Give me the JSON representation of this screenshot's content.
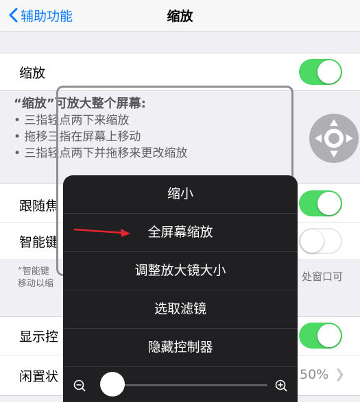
{
  "nav": {
    "back_label": "辅助功能",
    "title": "缩放"
  },
  "rows": {
    "zoom_label": "缩放",
    "follow_focus_label": "跟随焦",
    "smart_keyboard_label": "智能键",
    "show_controller_label": "显示控",
    "idle_label": "闲置状",
    "idle_value": "50%"
  },
  "description": {
    "title": "“缩放”可放大整个屏幕:",
    "bullet1": "• 三指轻点两下来缩放",
    "bullet2": "• 拖移三指在屏幕上移动",
    "bullet3": "• 三指轻点两下并拖移来更改缩放"
  },
  "note": {
    "left_line1": "“智能键",
    "left_line2": "移动以缩",
    "right_line1": "处窗口可"
  },
  "menu": {
    "items": [
      "缩小",
      "全屏幕缩放",
      "调整放大镜大小",
      "选取滤镜",
      "隐藏控制器"
    ]
  },
  "toggles": {
    "zoom": true,
    "follow_focus": true,
    "smart_keyboard": false,
    "show_controller": true
  },
  "slider": {
    "value": 0.05
  },
  "colors": {
    "accent": "#0a7bff",
    "toggle_on": "#4cd964",
    "menu_bg": "#202022",
    "arrow": "#e8242c"
  },
  "icons": {
    "back": "chevron-left-icon",
    "zoom_out": "zoom-out-icon",
    "zoom_in": "zoom-in-icon",
    "joystick": "joystick-arrows-icon",
    "disclosure": "chevron-right-icon"
  }
}
